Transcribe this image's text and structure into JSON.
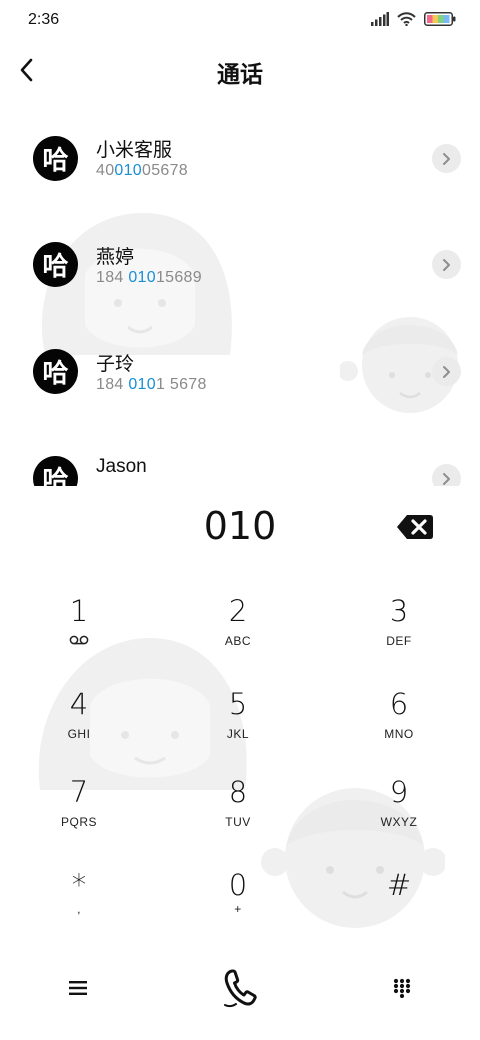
{
  "status_bar": {
    "time": "2:36",
    "icons": [
      "signal-icon",
      "wifi-icon",
      "battery-icon"
    ]
  },
  "header": {
    "title": "通话",
    "back_icon": "back-arrow-icon"
  },
  "contacts": [
    {
      "avatar": "哈",
      "name": "小米客服",
      "number_pre": "40",
      "number_match": "010",
      "number_post": "05678"
    },
    {
      "avatar": "哈",
      "name": "燕婷",
      "number_pre": "184 ",
      "number_match": "010",
      "number_post": "15689"
    },
    {
      "avatar": "哈",
      "name": "子玲",
      "number_pre": "184 ",
      "number_match": "010",
      "number_post": "1 5678"
    },
    {
      "avatar": "哈",
      "name": "Jason",
      "number_pre": "",
      "number_match": "",
      "number_post": ""
    }
  ],
  "dialer": {
    "input": "010",
    "backspace_icon": "backspace-icon"
  },
  "keys": [
    {
      "digit": "1",
      "letters": "",
      "sub_icon": "voicemail-icon"
    },
    {
      "digit": "2",
      "letters": "ABC"
    },
    {
      "digit": "3",
      "letters": "DEF"
    },
    {
      "digit": "4",
      "letters": "GHI"
    },
    {
      "digit": "5",
      "letters": "JKL"
    },
    {
      "digit": "6",
      "letters": "MNO"
    },
    {
      "digit": "7",
      "letters": "PQRS"
    },
    {
      "digit": "8",
      "letters": "TUV"
    },
    {
      "digit": "9",
      "letters": "WXYZ"
    },
    {
      "digit": "*",
      "letters": ","
    },
    {
      "digit": "0",
      "letters": "+"
    },
    {
      "digit": "#",
      "letters": ""
    }
  ],
  "bottom_bar": {
    "icons": [
      "menu-icon",
      "call-icon",
      "dialpad-icon"
    ]
  },
  "colors": {
    "highlight": "#1a8fd6",
    "avatar_bg": "#050505",
    "secondary_text": "#8a8a8a",
    "background_art": "#f0f0f0"
  }
}
